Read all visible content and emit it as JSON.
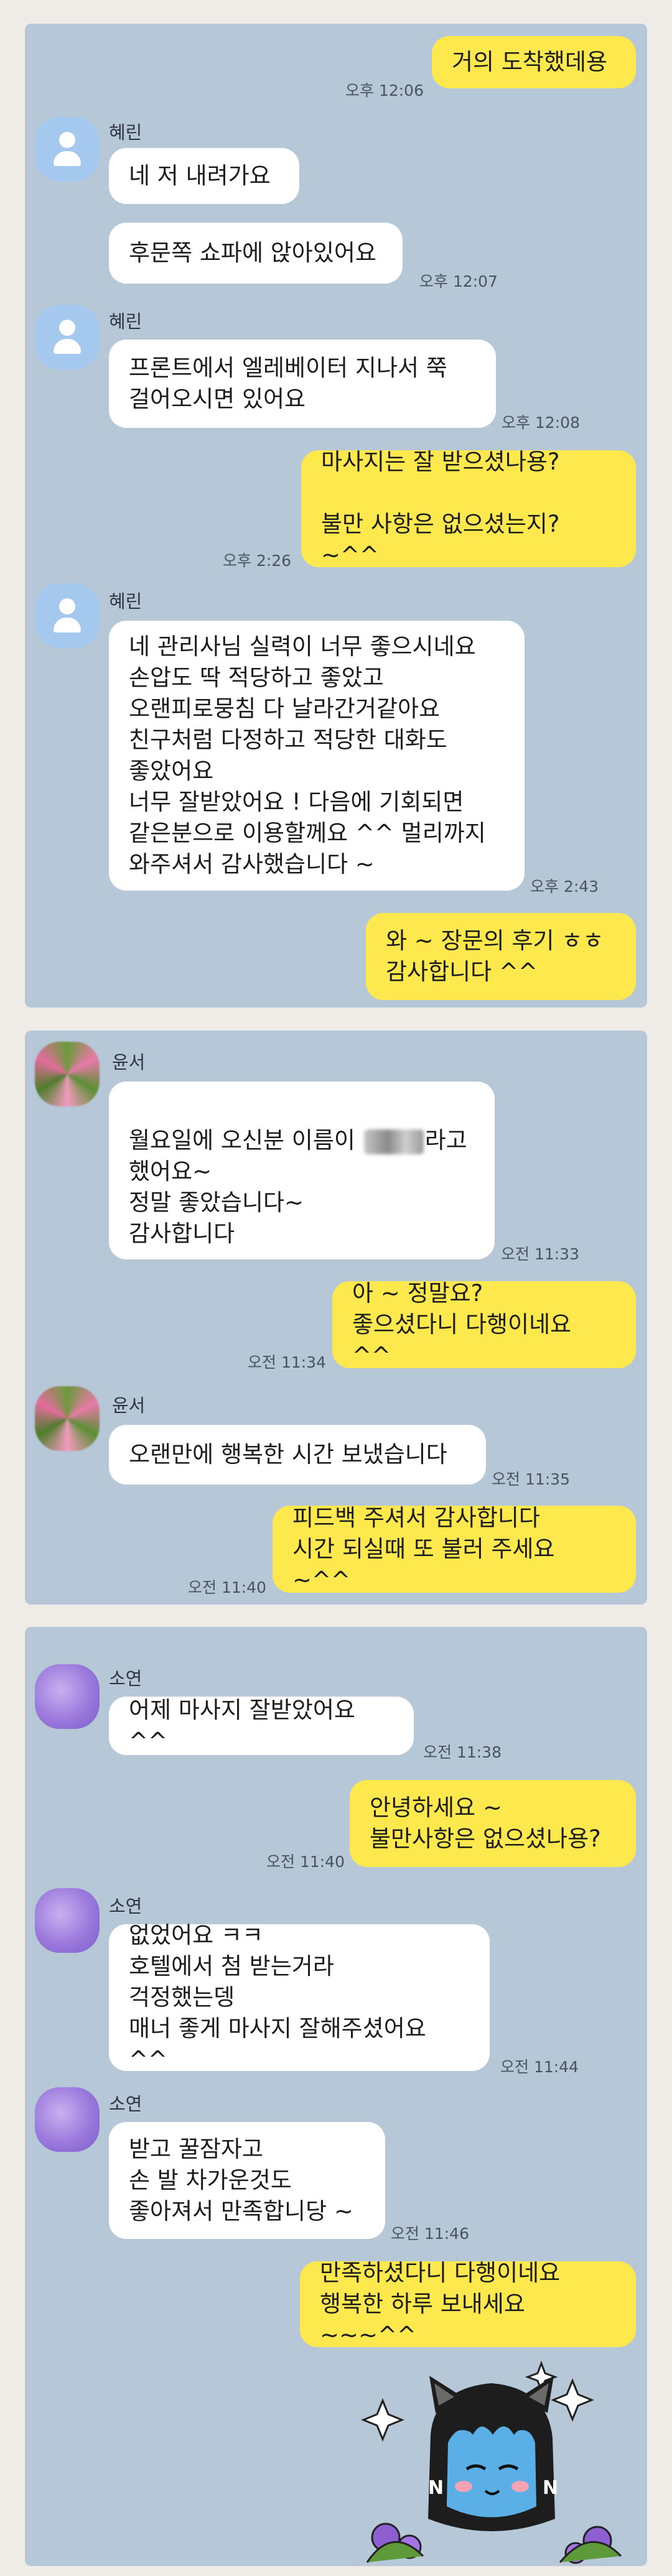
{
  "panel1": {
    "messages": [
      {
        "text": "거의 도착했데용",
        "time": "오후 12:06"
      },
      {
        "sender": "혜린",
        "text": "네 저 내려가요"
      },
      {
        "text": "후문쪽 쇼파에 앉아있어요",
        "time": "오후 12:07"
      },
      {
        "sender": "혜린",
        "text": "프론트에서 엘레베이터 지나서 쭉\n걸어오시면 있어요",
        "time": "오후 12:08"
      },
      {
        "text": "마사지는 잘 받으셨나용?\n\n불만 사항은 없으셨는지? ~^^",
        "time": "오후 2:26"
      },
      {
        "sender": "혜린",
        "text": "네 관리사님 실력이 너무 좋으시네요\n손압도 딱 적당하고 좋았고\n오랜피로뭉침 다 날라간거같아요\n친구처럼 다정하고 적당한 대화도\n좋았어요\n너무 잘받았어요 ! 다음에 기회되면\n같은분으로 이용할께요 ^^ 멀리까지\n와주셔서 감사했습니다 ~",
        "time": "오후 2:43"
      },
      {
        "text": "와 ~ 장문의 후기 ㅎㅎ\n감사합니다 ^^"
      }
    ]
  },
  "panel2": {
    "messages": [
      {
        "sender": "윤서",
        "text_before": "월요일에 오신분 이름이",
        "text_after": "라고\n했어요~\n정말 좋았습니다~\n감사합니다",
        "time": "오전 11:33"
      },
      {
        "text": "아 ~ 정말요?\n좋으셨다니 다행이네요 ^^",
        "time": "오전 11:34"
      },
      {
        "sender": "윤서",
        "text": "오랜만에 행복한 시간 보냈습니다",
        "time": "오전 11:35"
      },
      {
        "text": "피드백 주셔서 감사합니다\n시간 되실때 또 불러 주세요 ~^^",
        "time": "오전 11:40"
      }
    ]
  },
  "panel3": {
    "messages": [
      {
        "sender": "소연",
        "text": "어제 마사지 잘받았어요 ^^",
        "time": "오전 11:38"
      },
      {
        "text": "안녕하세요 ~\n불만사항은 없으셨나용?",
        "time": "오전 11:40"
      },
      {
        "sender": "소연",
        "text": "없었어요 ㅋㅋ\n호텔에서 첨 받는거라\n걱정했는뎅\n매너 좋게 마사지 잘해주셨어요 ^^",
        "time": "오전 11:44"
      },
      {
        "sender": "소연",
        "text": "받고 꿀잠자고\n손 발 차가운것도\n좋아져서 만족합니당 ~",
        "time": "오전 11:46"
      },
      {
        "text": "만족하셨다니 다행이네요\n행복한 하루 보내세요 ~~~^^"
      }
    ]
  },
  "colors": {
    "my_bubble": "#fde84d",
    "their_bubble": "#ffffff",
    "chat_bg": "#b6c7d8"
  },
  "sticker": {
    "icon": "kakao-neo-character-icon"
  }
}
